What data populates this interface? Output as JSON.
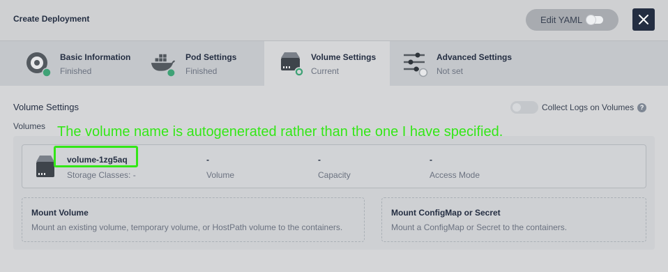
{
  "header": {
    "title": "Create Deployment",
    "edit_yaml_label": "Edit YAML"
  },
  "steps": [
    {
      "name": "Basic Information",
      "status": "Finished",
      "icon": "basic-info-icon",
      "state": "finished"
    },
    {
      "name": "Pod Settings",
      "status": "Finished",
      "icon": "docker-icon",
      "state": "finished"
    },
    {
      "name": "Volume Settings",
      "status": "Current",
      "icon": "storage-icon",
      "state": "current"
    },
    {
      "name": "Advanced Settings",
      "status": "Not set",
      "icon": "sliders-icon",
      "state": "not-set"
    }
  ],
  "volume_settings": {
    "title": "Volume Settings",
    "collect_logs_label": "Collect Logs on Volumes",
    "collect_logs_enabled": false,
    "help_glyph": "?",
    "volumes_label": "Volumes",
    "volume": {
      "name": "volume-1zg5aq",
      "storage_class": "Storage Classes: -",
      "volume_value": "-",
      "volume_label": "Volume",
      "capacity_value": "-",
      "capacity_label": "Capacity",
      "access_mode_value": "-",
      "access_mode_label": "Access Mode"
    },
    "mount_volume": {
      "title": "Mount Volume",
      "description": "Mount an existing volume, temporary volume, or HostPath volume to the containers."
    },
    "mount_config": {
      "title": "Mount ConfigMap or Secret",
      "description": "Mount a ConfigMap or Secret to the containers."
    }
  },
  "annotation": {
    "text": "The volume name is autogenerated rather than the one I have specified.",
    "color": "#33e617"
  },
  "colors": {
    "finished_badge": "#3fa276",
    "dark": "#242e42"
  }
}
